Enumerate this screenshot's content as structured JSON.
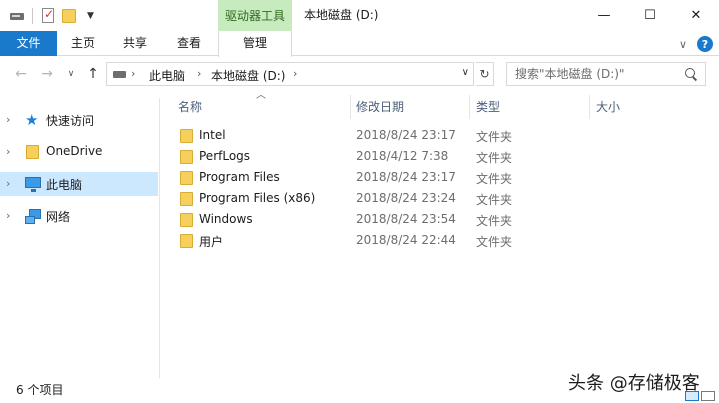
{
  "titlebar": {
    "qat": [
      "drive",
      "properties",
      "new-folder",
      "customize"
    ],
    "context_tab_header": "驱动器工具",
    "window_title": "本地磁盘 (D:)",
    "minimize": "—",
    "maximize": "☐",
    "close": "✕"
  },
  "ribbon": {
    "tabs": [
      "文件",
      "主页",
      "共享",
      "查看",
      "管理"
    ],
    "file_tab_color": "#1979ca",
    "context_color": "#c8eabf",
    "help": "?"
  },
  "nav": {
    "back": "←",
    "forward": "→",
    "recent": "∨",
    "up": "↑",
    "breadcrumb": [
      "此电脑",
      "本地磁盘 (D:)"
    ],
    "search_placeholder": "搜索\"本地磁盘 (D:)\""
  },
  "navpane": {
    "items": [
      {
        "label": "快速访问",
        "icon": "star-icon"
      },
      {
        "label": "OneDrive",
        "icon": "onedrive-icon"
      },
      {
        "label": "此电脑",
        "icon": "pc-icon",
        "selected": true
      },
      {
        "label": "网络",
        "icon": "network-icon"
      }
    ]
  },
  "columns": {
    "name": "名称",
    "date": "修改日期",
    "type": "类型",
    "size": "大小"
  },
  "files": [
    {
      "name": "Intel",
      "date": "2018/8/24 23:17",
      "type": "文件夹"
    },
    {
      "name": "PerfLogs",
      "date": "2018/4/12 7:38",
      "type": "文件夹"
    },
    {
      "name": "Program Files",
      "date": "2018/8/24 23:17",
      "type": "文件夹"
    },
    {
      "name": "Program Files (x86)",
      "date": "2018/8/24 23:24",
      "type": "文件夹"
    },
    {
      "name": "Windows",
      "date": "2018/8/24 23:54",
      "type": "文件夹"
    },
    {
      "name": "用户",
      "date": "2018/8/24 22:44",
      "type": "文件夹"
    }
  ],
  "status": {
    "item_count": "6 个项目"
  },
  "watermark": "头条 @存储极客"
}
